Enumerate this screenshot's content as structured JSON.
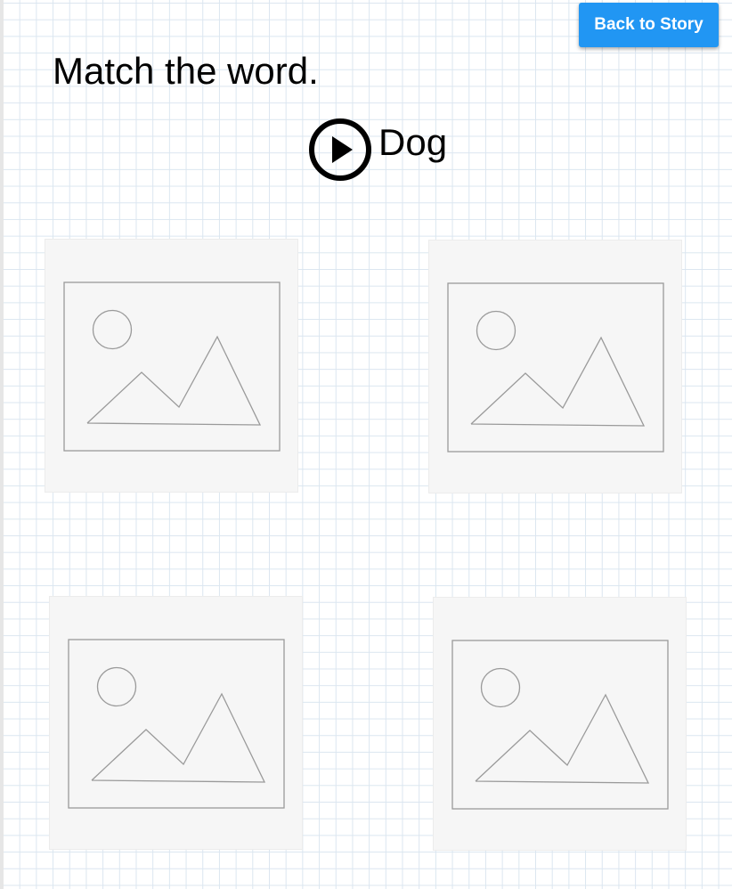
{
  "header": {
    "back_label": "Back to Story",
    "accent_color": "#2196f3"
  },
  "activity": {
    "instruction": "Match the word.",
    "word": "Dog",
    "play_icon": "play-circle-icon"
  },
  "choices": [
    {
      "icon": "image-placeholder-icon"
    },
    {
      "icon": "image-placeholder-icon"
    },
    {
      "icon": "image-placeholder-icon"
    },
    {
      "icon": "image-placeholder-icon"
    }
  ]
}
